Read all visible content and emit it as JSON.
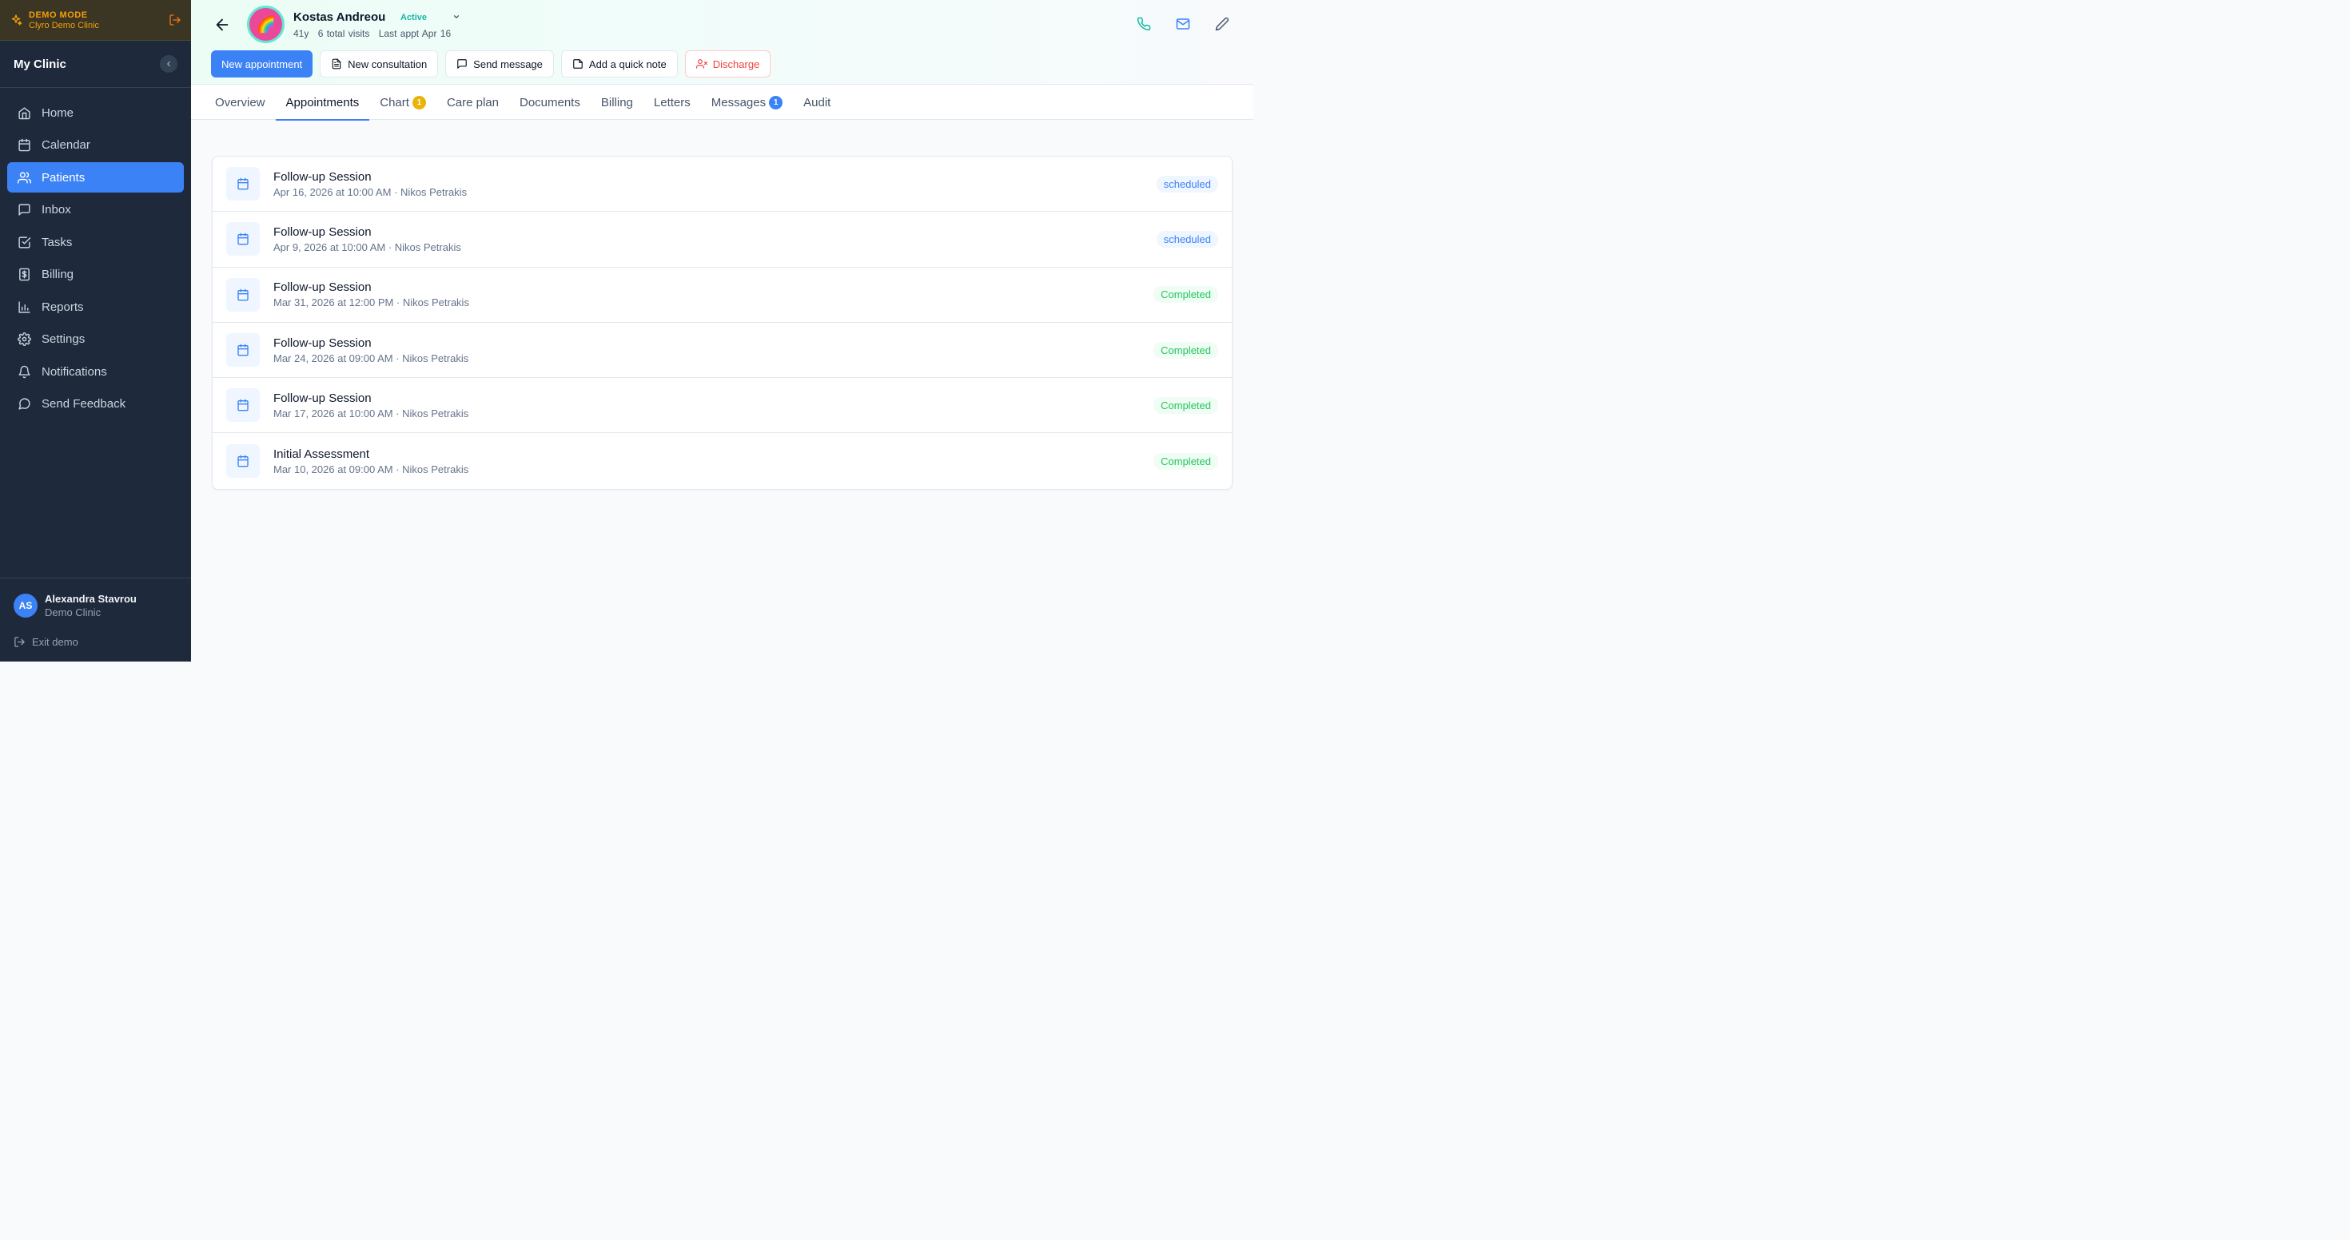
{
  "demo": {
    "title": "DEMO MODE",
    "clinic": "Clyro Demo Clinic"
  },
  "sidebar": {
    "clinic_name": "My Clinic",
    "items": [
      {
        "label": "Home",
        "icon": "home-icon"
      },
      {
        "label": "Calendar",
        "icon": "calendar-icon"
      },
      {
        "label": "Patients",
        "icon": "users-icon",
        "active": true
      },
      {
        "label": "Inbox",
        "icon": "message-square-icon"
      },
      {
        "label": "Tasks",
        "icon": "check-square-icon"
      },
      {
        "label": "Billing",
        "icon": "receipt-icon"
      },
      {
        "label": "Reports",
        "icon": "bar-chart-icon"
      },
      {
        "label": "Settings",
        "icon": "gear-icon"
      },
      {
        "label": "Notifications",
        "icon": "bell-icon"
      },
      {
        "label": "Send Feedback",
        "icon": "message-circle-icon"
      }
    ],
    "user": {
      "initials": "AS",
      "name": "Alexandra Stavrou",
      "clinic": "Demo Clinic"
    },
    "exit_label": "Exit demo"
  },
  "patient": {
    "avatar_emoji": "🌈",
    "name": "Kostas Andreou",
    "status": "Active",
    "age": "41y",
    "visits": "6 total visits",
    "last_appt": "Last appt Apr 16"
  },
  "actions": {
    "new_appointment": "New appointment",
    "new_consultation": "New consultation",
    "send_message": "Send message",
    "quick_note": "Add a quick note",
    "discharge": "Discharge"
  },
  "tabs": [
    {
      "label": "Overview"
    },
    {
      "label": "Appointments",
      "active": true
    },
    {
      "label": "Chart",
      "badge": "1",
      "badge_color": "amber"
    },
    {
      "label": "Care plan"
    },
    {
      "label": "Documents"
    },
    {
      "label": "Billing"
    },
    {
      "label": "Letters"
    },
    {
      "label": "Messages",
      "badge": "1",
      "badge_color": "blue"
    },
    {
      "label": "Audit"
    }
  ],
  "appointments": [
    {
      "title": "Follow-up Session",
      "details": "Apr 16, 2026 at 10:00 AM · Nikos Petrakis",
      "status": "scheduled"
    },
    {
      "title": "Follow-up Session",
      "details": "Apr 9, 2026 at 10:00 AM · Nikos Petrakis",
      "status": "scheduled"
    },
    {
      "title": "Follow-up Session",
      "details": "Mar 31, 2026 at 12:00 PM · Nikos Petrakis",
      "status": "Completed"
    },
    {
      "title": "Follow-up Session",
      "details": "Mar 24, 2026 at 09:00 AM · Nikos Petrakis",
      "status": "Completed"
    },
    {
      "title": "Follow-up Session",
      "details": "Mar 17, 2026 at 10:00 AM · Nikos Petrakis",
      "status": "Completed"
    },
    {
      "title": "Initial Assessment",
      "details": "Mar 10, 2026 at 09:00 AM · Nikos Petrakis",
      "status": "Completed"
    }
  ],
  "colors": {
    "accent": "#3b82f6",
    "sidebar_bg": "#1e293b",
    "demo_amber": "#f59e0b",
    "status_active": "#14b8a6",
    "completed_green": "#22c55e",
    "discharge_red": "#ef4444"
  }
}
